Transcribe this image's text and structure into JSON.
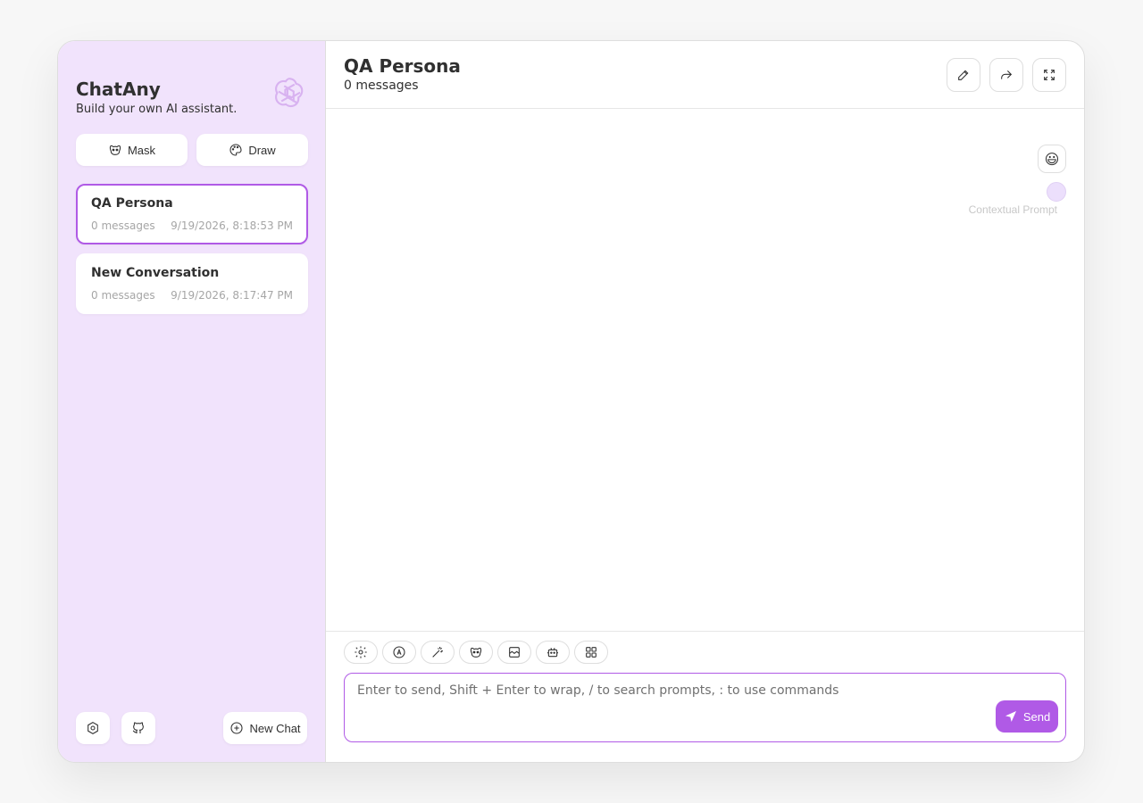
{
  "app": {
    "name": "ChatAny",
    "tagline": "Build your own AI assistant."
  },
  "sidebar": {
    "top_buttons": [
      {
        "label": "Mask",
        "icon": "mask-icon"
      },
      {
        "label": "Draw",
        "icon": "palette-icon"
      }
    ],
    "conversations": [
      {
        "title": "QA Persona",
        "count": "0 messages",
        "time": "9/19/2026, 8:18:53 PM",
        "selected": true
      },
      {
        "title": "New Conversation",
        "count": "0 messages",
        "time": "9/19/2026, 8:17:47 PM",
        "selected": false
      }
    ],
    "footer": {
      "new_chat_label": "New Chat",
      "icons": [
        "settings-icon",
        "github-icon",
        "plus-circle-icon"
      ]
    }
  },
  "header": {
    "title": "QA Persona",
    "subtitle": "0 messages",
    "actions": [
      "edit-icon",
      "share-icon",
      "fullscreen-icon"
    ]
  },
  "messages": {
    "avatar": "😃",
    "context_label": "Contextual Prompt"
  },
  "input": {
    "placeholder": "Enter to send, Shift + Enter to wrap, / to search prompts, : to use commands",
    "value": "",
    "send_label": "Send",
    "toolbar": [
      "settings-icon",
      "theme-icon",
      "magic-wand-icon",
      "mask-icon",
      "image-icon",
      "robot-icon",
      "apps-icon"
    ]
  },
  "colors": {
    "accent": "#b05ae6",
    "sidebar_bg": "#f1e3fc",
    "text": "#303030",
    "muted": "#a6a6a6"
  }
}
